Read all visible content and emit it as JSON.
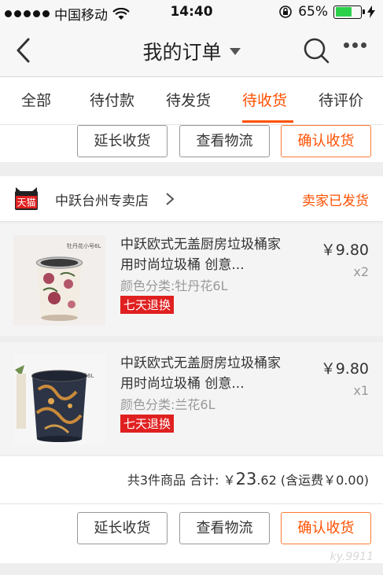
{
  "status_bar": {
    "carrier": "中国移动",
    "time": "14:40",
    "battery_percent": "65%",
    "battery_level": 0.65,
    "battery_color": "#2bd14b"
  },
  "nav": {
    "title": "我的订单",
    "back_icon": "chevron-left-icon",
    "search_icon": "search-icon",
    "more_icon": "more-dots-icon"
  },
  "tabs": [
    {
      "label": "全部",
      "active": false
    },
    {
      "label": "待付款",
      "active": false
    },
    {
      "label": "待发货",
      "active": false
    },
    {
      "label": "待收货",
      "active": true
    },
    {
      "label": "待评价",
      "active": false
    }
  ],
  "accent_color": "#ff5000",
  "top_actions": {
    "extend": "延长收货",
    "logistics": "查看物流",
    "confirm": "确认收货"
  },
  "order": {
    "shop_badge": "天猫",
    "shop_name": "中跃台州专卖店",
    "status": "卖家已发货",
    "items": [
      {
        "title": "中跃欧式无盖厨房垃圾桶家用时尚垃圾桶 创意...",
        "sku": "颜色分类:牡丹花6L",
        "badge": "七天退换",
        "price": "￥9.80",
        "qty": "x2",
        "image_label": "牡丹花小号6L"
      },
      {
        "title": "中跃欧式无盖厨房垃圾桶家用时尚垃圾桶 创意...",
        "sku": "颜色分类:兰花6L",
        "badge": "七天退换",
        "price": "￥9.80",
        "qty": "x1",
        "image_label": "小号6L"
      }
    ],
    "summary_prefix": "共3件商品 合计: ￥",
    "summary_int": "23",
    "summary_dec": ".62",
    "summary_suffix": " (含运费￥0.00)"
  },
  "bottom_actions": {
    "extend": "延长收货",
    "logistics": "查看物流",
    "confirm": "确认收货"
  },
  "watermark": "ky.9911"
}
